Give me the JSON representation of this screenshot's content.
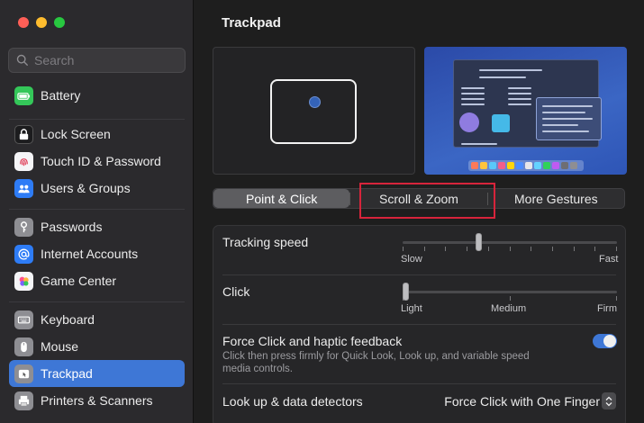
{
  "window": {
    "traffic_lights": [
      "close",
      "minimize",
      "zoom"
    ]
  },
  "sidebar": {
    "search_placeholder": "Search",
    "items": [
      {
        "label": "Battery",
        "icon": "battery-icon",
        "color": "#34c759"
      },
      {
        "label": "Lock Screen",
        "icon": "lock-icon",
        "color": "#1c1c1e"
      },
      {
        "label": "Touch ID & Password",
        "icon": "fingerprint-icon",
        "color": "#f5f5f7"
      },
      {
        "label": "Users & Groups",
        "icon": "users-icon",
        "color": "#2e7cf6"
      },
      {
        "label": "Passwords",
        "icon": "key-icon",
        "color": "#8e8e93"
      },
      {
        "label": "Internet Accounts",
        "icon": "at-icon",
        "color": "#2e7cf6"
      },
      {
        "label": "Game Center",
        "icon": "game-center-icon",
        "color": "#f5f5f7"
      },
      {
        "label": "Keyboard",
        "icon": "keyboard-icon",
        "color": "#8e8e93"
      },
      {
        "label": "Mouse",
        "icon": "mouse-icon",
        "color": "#8e8e93"
      },
      {
        "label": "Trackpad",
        "icon": "trackpad-icon",
        "color": "#8e8e93",
        "active": true
      },
      {
        "label": "Printers & Scanners",
        "icon": "printer-icon",
        "color": "#8e8e93"
      }
    ]
  },
  "main": {
    "title": "Trackpad",
    "tabs": [
      {
        "label": "Point & Click",
        "selected": true
      },
      {
        "label": "Scroll & Zoom",
        "selected": false
      },
      {
        "label": "More Gestures",
        "selected": false
      }
    ],
    "settings": {
      "tracking_speed": {
        "label": "Tracking speed",
        "min_label": "Slow",
        "max_label": "Fast",
        "value_fraction": 0.35
      },
      "click": {
        "label": "Click",
        "left_label": "Light",
        "mid_label": "Medium",
        "right_label": "Firm",
        "value_fraction": 0.0
      },
      "force_click": {
        "label": "Force Click and haptic feedback",
        "description": "Click then press firmly for Quick Look, Look up, and variable speed media controls.",
        "enabled": true
      },
      "lookup": {
        "label": "Look up & data detectors",
        "value": "Force Click with One Finger"
      }
    }
  },
  "colors": {
    "accent": "#3e77d6",
    "highlight": "#d7243b"
  }
}
